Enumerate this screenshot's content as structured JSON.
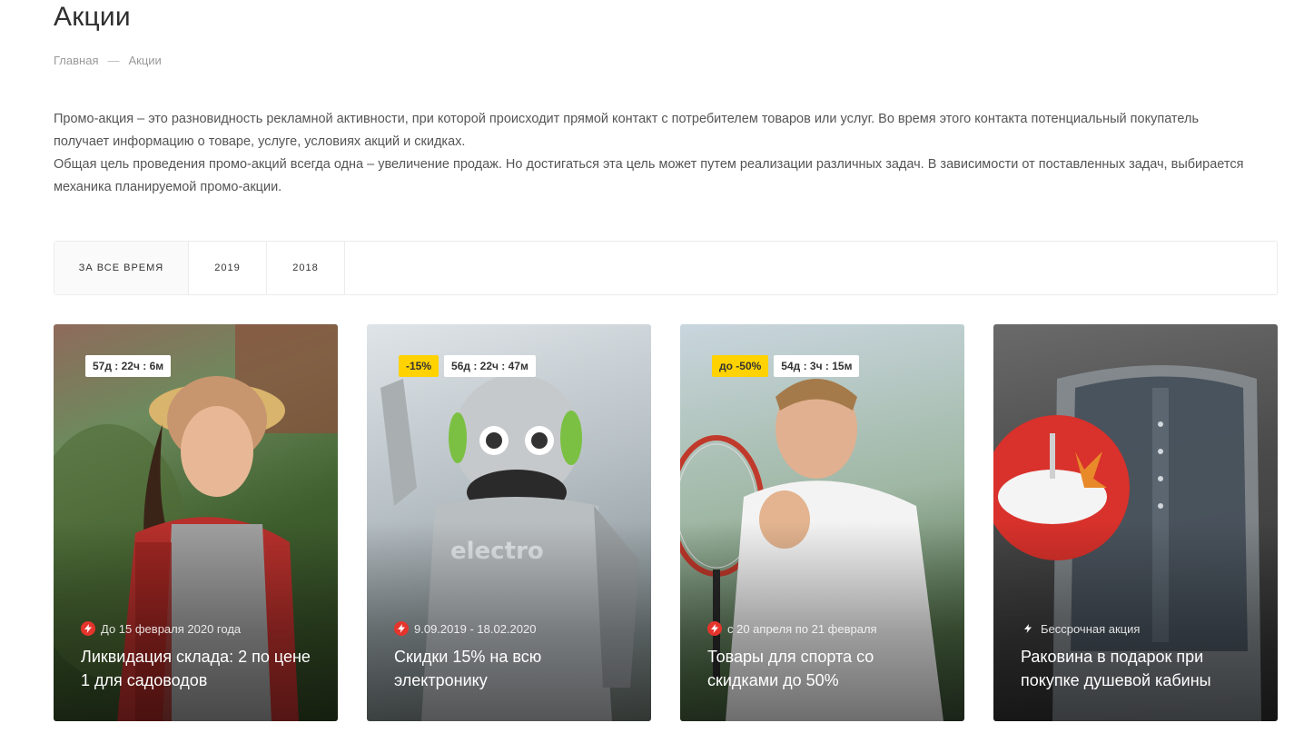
{
  "page": {
    "title": "Акции",
    "breadcrumb": [
      {
        "label": "Главная"
      },
      {
        "label": "Акции"
      }
    ],
    "breadcrumb_separator": "—",
    "intro": [
      "Промо-акция – это разновидность рекламной активности, при которой происходит прямой контакт с потребителем товаров или услуг. Во время этого контакта потенциальный покупатель получает информацию о товаре, услуге, условиях акций и скидках.",
      "Общая цель проведения промо-акций всегда одна – увеличение продаж. Но достигаться эта цель может путем реализации различных задач. В зависимости от поставленных задач, выбирается механика планируемой промо-акции."
    ]
  },
  "tabs": [
    {
      "label": "За все время",
      "active": true
    },
    {
      "label": "2019",
      "active": false
    },
    {
      "label": "2018",
      "active": false
    }
  ],
  "cards": [
    {
      "sale": "",
      "timer": "57д : 22ч : 6м",
      "date": "До 15 февраля 2020 года",
      "title": "Ликвидация склада: 2 по цене 1 для садоводов",
      "icon": "lightning-icon",
      "icon_style": "red"
    },
    {
      "sale": "-15%",
      "timer": "56д : 22ч : 47м",
      "date": "9.09.2019 - 18.02.2020",
      "title": "Скидки 15% на всю электронику",
      "icon": "lightning-icon",
      "icon_style": "red"
    },
    {
      "sale": "до -50%",
      "timer": "54д : 3ч : 15м",
      "date": "с 20 апреля по 21 февраля",
      "title": "Товары для спорта со скидками до 50%",
      "icon": "lightning-icon",
      "icon_style": "red"
    },
    {
      "sale": "",
      "timer": "",
      "date": "Бессрочная акция",
      "title": "Раковина в подарок при покупке душевой кабины",
      "icon": "lightning-icon",
      "icon_style": "plain"
    }
  ],
  "colors": {
    "accent_red": "#e5342c",
    "sale_yellow": "#ffd200",
    "text_dark": "#2f2f2f",
    "text_muted": "#999999"
  }
}
